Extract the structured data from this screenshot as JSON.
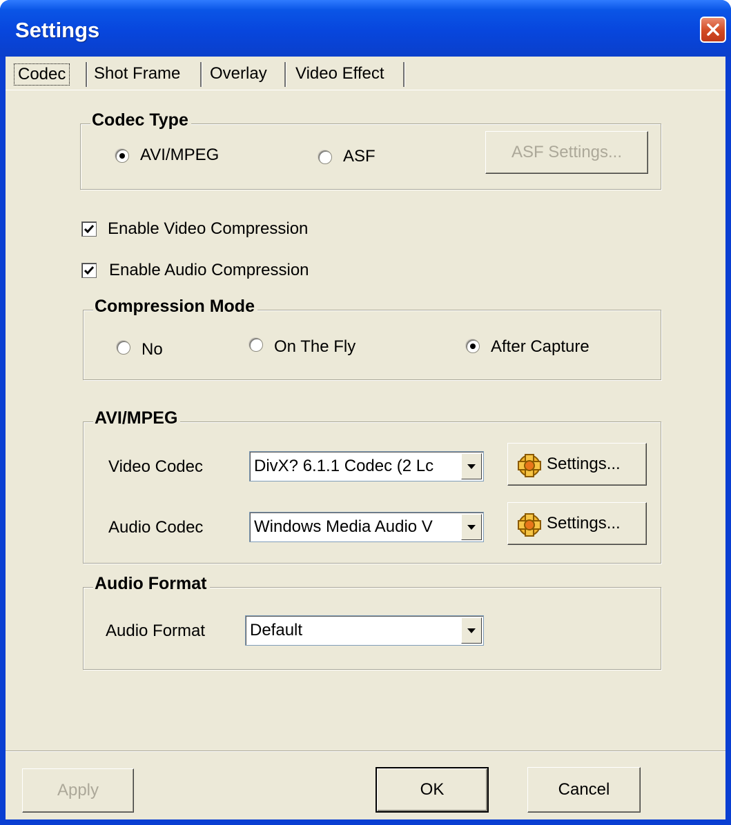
{
  "window": {
    "title": "Settings"
  },
  "tabs": [
    "Codec",
    "Shot Frame",
    "Overlay",
    "Video Effect"
  ],
  "codec_type": {
    "legend": "Codec Type",
    "options": [
      "AVI/MPEG",
      "ASF"
    ],
    "selected": "AVI/MPEG",
    "asf_settings_label": "ASF Settings..."
  },
  "checkboxes": {
    "video": {
      "label": "Enable Video Compression",
      "checked": true
    },
    "audio": {
      "label": "Enable Audio Compression",
      "checked": true
    }
  },
  "compression_mode": {
    "legend": "Compression Mode",
    "options": [
      "No",
      "On The Fly",
      "After Capture"
    ],
    "selected": "After Capture"
  },
  "avi_mpeg": {
    "legend": "AVI/MPEG",
    "video_codec_label": "Video Codec",
    "video_codec_value": "DivX? 6.1.1 Codec (2 Lc",
    "audio_codec_label": "Audio Codec",
    "audio_codec_value": "Windows Media Audio V",
    "settings_label": "Settings..."
  },
  "audio_format": {
    "legend": "Audio Format",
    "label": "Audio Format",
    "value": "Default"
  },
  "footer": {
    "apply": "Apply",
    "ok": "OK",
    "cancel": "Cancel"
  },
  "colors": {
    "titlebar": "#0a50df",
    "face": "#ece9d8",
    "close": "#d24a22",
    "disabled_text": "#aca899"
  }
}
